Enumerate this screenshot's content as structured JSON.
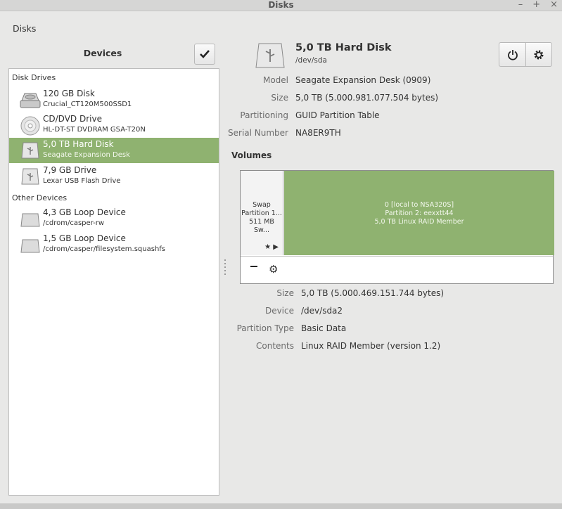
{
  "window": {
    "title": "Disks"
  },
  "menu": {
    "label": "Disks"
  },
  "devices_panel": {
    "header": "Devices",
    "sections": [
      {
        "title": "Disk Drives",
        "devices": [
          {
            "name": "120 GB Disk",
            "sub": "Crucial_CT120M500SSD1",
            "icon": "hard-disk-icon"
          },
          {
            "name": "CD/DVD Drive",
            "sub": "HL-DT-ST DVDRAM GSA-T20N",
            "icon": "optical-disc-icon"
          },
          {
            "name": "5,0 TB Hard Disk",
            "sub": "Seagate Expansion Desk",
            "icon": "usb-drive-icon",
            "selected": true
          },
          {
            "name": "7,9 GB Drive",
            "sub": "Lexar USB Flash Drive",
            "icon": "usb-drive-icon"
          }
        ]
      },
      {
        "title": "Other Devices",
        "devices": [
          {
            "name": "4,3 GB Loop Device",
            "sub": "/cdrom/casper-rw",
            "icon": "loop-device-icon"
          },
          {
            "name": "1,5 GB Loop Device",
            "sub": "/cdrom/casper/filesystem.squashfs",
            "icon": "loop-device-icon"
          }
        ]
      }
    ]
  },
  "disk": {
    "title": "5,0 TB Hard Disk",
    "device": "/dev/sda",
    "props": [
      {
        "label": "Model",
        "value": "Seagate Expansion Desk (0909)"
      },
      {
        "label": "Size",
        "value": "5,0 TB (5.000.981.077.504 bytes)"
      },
      {
        "label": "Partitioning",
        "value": "GUID Partition Table"
      },
      {
        "label": "Serial Number",
        "value": "NA8ER9TH"
      }
    ]
  },
  "volumes": {
    "heading": "Volumes",
    "swap": {
      "line1": "Swap",
      "line2": "Partition 1...",
      "line3": "511 MB Sw..."
    },
    "raid": {
      "line1": "0 [local to NSA320S]",
      "line2": "Partition 2: eexxtt44",
      "line3": "5,0 TB Linux RAID Member"
    },
    "props": [
      {
        "label": "Size",
        "value": "5,0 TB (5.000.469.151.744 bytes)"
      },
      {
        "label": "Device",
        "value": "/dev/sda2"
      },
      {
        "label": "Partition Type",
        "value": "Basic Data"
      },
      {
        "label": "Contents",
        "value": "Linux RAID Member (version 1.2)"
      }
    ]
  },
  "colors": {
    "selection": "#8fb270",
    "window_bg": "#e8e8e7"
  }
}
